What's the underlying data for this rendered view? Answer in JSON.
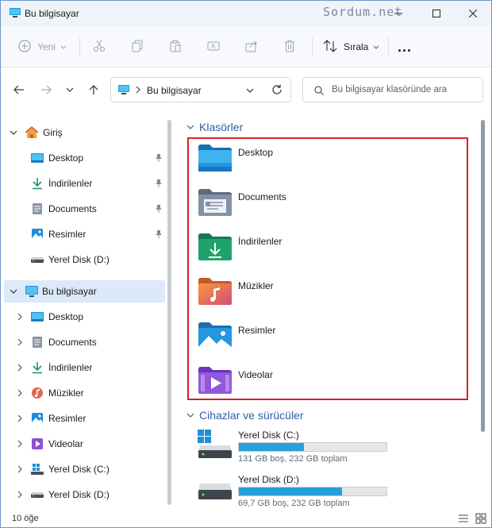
{
  "window": {
    "title": "Bu bilgisayar",
    "watermark": "Sordum.net"
  },
  "commandbar": {
    "new_label": "Yeni",
    "sort_label": "Sırala",
    "more_label": "..."
  },
  "address": {
    "path": "Bu bilgisayar",
    "search_placeholder": "Bu bilgisayar klasöründe ara"
  },
  "sidebar": {
    "items": [
      {
        "label": "Giriş"
      },
      {
        "label": "Desktop"
      },
      {
        "label": "İndirilenler"
      },
      {
        "label": "Documents"
      },
      {
        "label": "Resimler"
      },
      {
        "label": "Yerel Disk (D:)"
      },
      {
        "label": "Bu bilgisayar"
      },
      {
        "label": "Desktop"
      },
      {
        "label": "Documents"
      },
      {
        "label": "İndirilenler"
      },
      {
        "label": "Müzikler"
      },
      {
        "label": "Resimler"
      },
      {
        "label": "Videolar"
      },
      {
        "label": "Yerel Disk (C:)"
      },
      {
        "label": "Yerel Disk (D:)"
      }
    ]
  },
  "main": {
    "folders_header": "Klasörler",
    "folders": [
      {
        "name": "Desktop"
      },
      {
        "name": "Documents"
      },
      {
        "name": "İndirilenler"
      },
      {
        "name": "Müzikler"
      },
      {
        "name": "Resimler"
      },
      {
        "name": "Videolar"
      }
    ],
    "drives_header": "Cihazlar ve sürücüler",
    "drives": [
      {
        "name": "Yerel Disk (C:)",
        "info": "131 GB boş, 232 GB toplam",
        "used_fraction": 0.44
      },
      {
        "name": "Yerel Disk (D:)",
        "info": "69,7 GB boş, 232 GB toplam",
        "used_fraction": 0.7
      }
    ]
  },
  "status": {
    "count": "10 öğe"
  },
  "colors": {
    "accent": "#26a0da",
    "highlight_border": "#d51f2a",
    "group_header": "#2e5fa8",
    "selection": "#dbe9f8"
  }
}
